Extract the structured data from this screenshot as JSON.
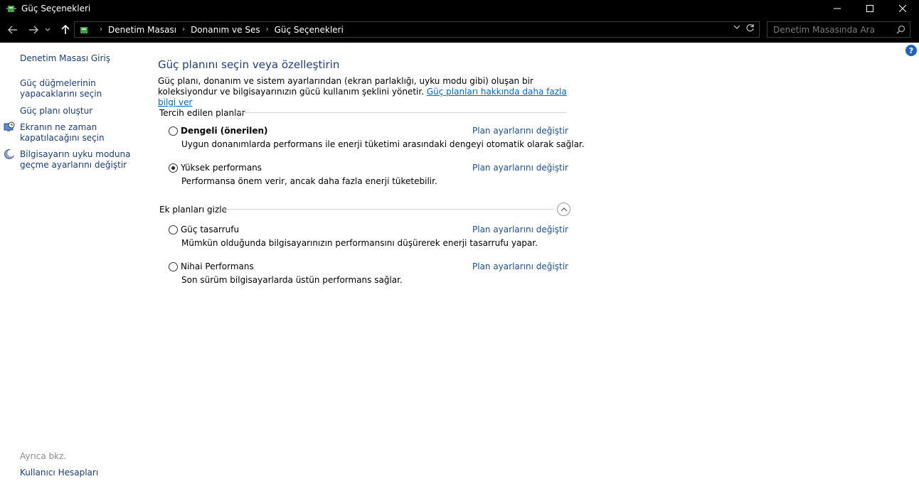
{
  "window": {
    "title": "Güç Seçenekleri",
    "controls": {
      "minimize": "minimize-icon",
      "maximize": "maximize-icon",
      "close": "close-icon"
    }
  },
  "breadcrumb": [
    "Denetim Masası",
    "Donanım ve Ses",
    "Güç Seçenekleri"
  ],
  "search": {
    "placeholder": "Denetim Masasında Ara"
  },
  "sidebar": {
    "home": "Denetim Masası Giriş",
    "items": [
      {
        "label_line1": "Güç düğmelerinin",
        "label_line2": "yapacaklarını seçin"
      },
      {
        "label_line1": "Güç planı oluştur",
        "label_line2": ""
      },
      {
        "label_line1": "Ekranın ne zaman",
        "label_line2": "kapatılacağını seçin",
        "icon": "monitor-clock-icon"
      },
      {
        "label_line1": "Bilgisayarın uyku moduna",
        "label_line2": "geçme ayarlarını değiştir",
        "icon": "moon-icon"
      }
    ],
    "see_also": "Ayrıca bkz.",
    "user_accounts": "Kullanıcı Hesapları"
  },
  "main": {
    "title": "Güç planını seçin veya özelleştirin",
    "description": "Güç planı, donanım ve sistem ayarlarından (ekran parlaklığı, uyku modu gibi) oluşan bir koleksiyondur ve bilgisayarınızın gücü kullanım şeklini yönetir.",
    "learn_more": "Güç planları hakkında daha fazla bilgi ver",
    "preferred_group": "Tercih edilen planlar",
    "hidden_group": "Ek planları gizle",
    "change_link": "Plan ayarlarını değiştir",
    "plans": [
      {
        "name": "Dengeli (önerilen)",
        "desc": "Uygun donanımlarda performans ile enerji tüketimi arasındaki dengeyi otomatik olarak sağlar.",
        "selected": false,
        "bold": true
      },
      {
        "name": "Yüksek performans",
        "desc": "Performansa önem verir, ancak daha fazla enerji tüketebilir.",
        "selected": true,
        "bold": false
      },
      {
        "name": "Güç tasarrufu",
        "desc": "Mümkün olduğunda bilgisayarınızın performansını düşürerek enerji tasarrufu yapar.",
        "selected": false,
        "bold": false
      },
      {
        "name": "Nihai Performans",
        "desc": "Son sürüm bilgisayarlarda üstün performans sağlar.",
        "selected": false,
        "bold": false
      }
    ]
  },
  "colors": {
    "link": "#1a3a7e",
    "title": "#1e3c87",
    "help": "#1c64c4"
  }
}
